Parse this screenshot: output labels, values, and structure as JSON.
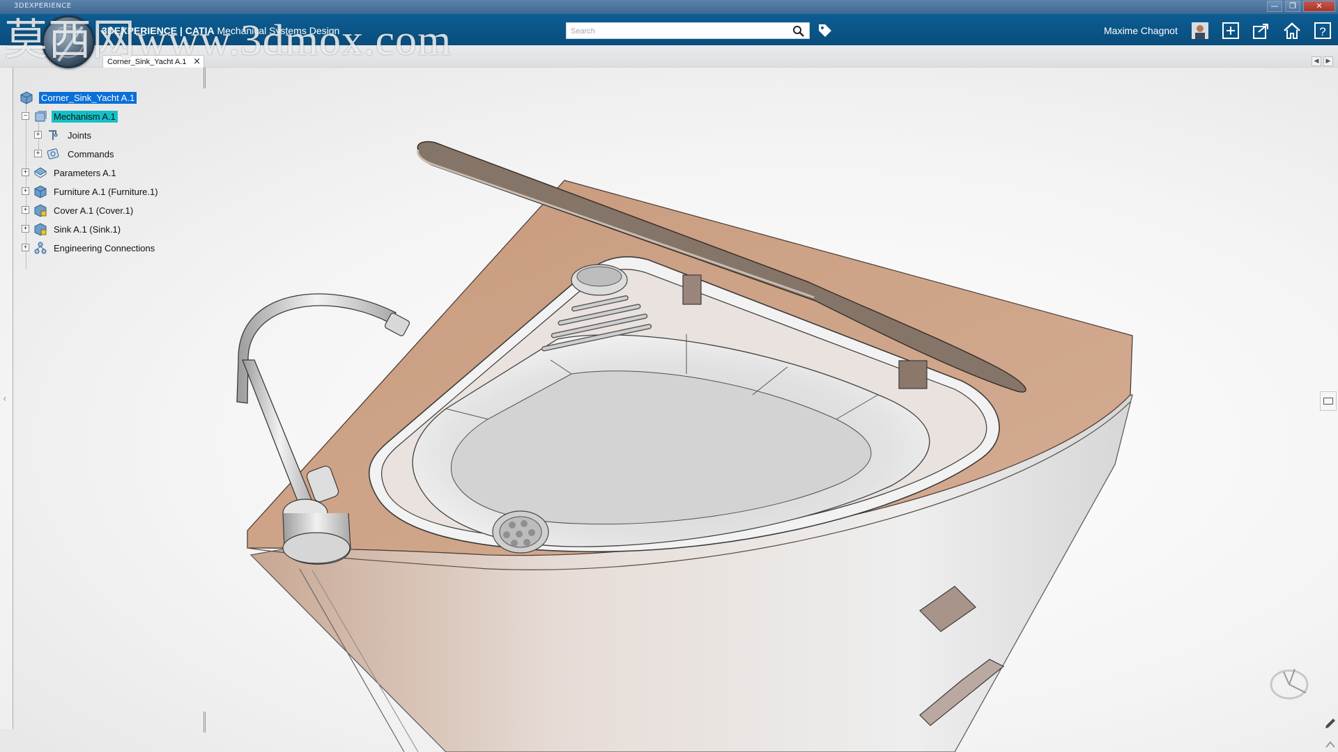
{
  "window": {
    "title": "3DEXPERIENCE",
    "controls": [
      "—",
      "❐",
      "✕"
    ]
  },
  "header": {
    "app_title_bold": "3DEXPERIENCE | CATIA",
    "app_title_rest": "Mechanical Systems Design",
    "watermark": "莫西网www.3dmox.com",
    "search_placeholder": "Search",
    "user_name": "Maxime Chagnot"
  },
  "tabs": {
    "active": "Corner_Sink_Yacht A.1",
    "close": "×"
  },
  "tree": {
    "root": "Corner_Sink_Yacht A.1",
    "items": [
      {
        "label": "Mechanism A.1",
        "level": 1,
        "expanded": true
      },
      {
        "label": "Joints",
        "level": 2
      },
      {
        "label": "Commands",
        "level": 2
      },
      {
        "label": "Parameters A.1",
        "level": 1
      },
      {
        "label": "Furniture A.1 (Furniture.1)",
        "level": 1
      },
      {
        "label": "Cover A.1 (Cover.1)",
        "level": 1
      },
      {
        "label": "Sink A.1 (Sink.1)",
        "level": 1
      },
      {
        "label": "Engineering Connections",
        "level": 1
      }
    ]
  },
  "colors": {
    "topbar": "#0d5d93",
    "selection": "#0b6fd8",
    "selection_secondary": "#14c0c8",
    "wood": "#c9a48b",
    "lid": "#8b7e73"
  },
  "icons": {
    "search": "magnifier",
    "tag": "tag",
    "add": "plus",
    "share": "share-arrow",
    "home": "house",
    "help": "question"
  }
}
